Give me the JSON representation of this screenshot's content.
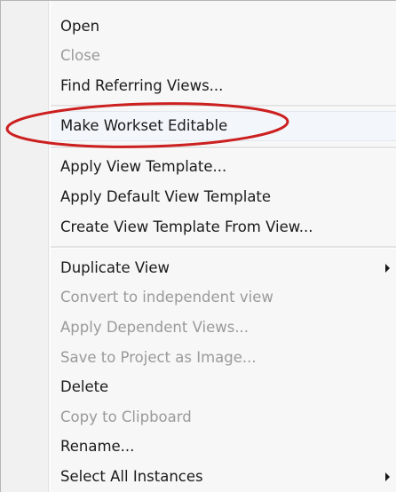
{
  "menu": {
    "items": [
      {
        "label": "Open",
        "enabled": true
      },
      {
        "label": "Close",
        "enabled": false
      },
      {
        "label": "Find Referring Views...",
        "enabled": true
      },
      {
        "label": "Make Workset Editable",
        "enabled": true
      },
      {
        "label": "Apply View Template...",
        "enabled": true
      },
      {
        "label": "Apply Default View Template",
        "enabled": true
      },
      {
        "label": "Create View Template From View...",
        "enabled": true
      },
      {
        "label": "Duplicate View",
        "enabled": true,
        "submenu": true
      },
      {
        "label": "Convert to independent view",
        "enabled": false
      },
      {
        "label": "Apply Dependent Views...",
        "enabled": false
      },
      {
        "label": "Save to Project as Image...",
        "enabled": false
      },
      {
        "label": "Delete",
        "enabled": true
      },
      {
        "label": "Copy to Clipboard",
        "enabled": false
      },
      {
        "label": "Rename...",
        "enabled": true
      },
      {
        "label": "Select All Instances",
        "enabled": true,
        "submenu": true
      }
    ]
  },
  "annotation": {
    "highlight_color": "#cc1f1f"
  },
  "colors": {
    "text": "#1a1a1a",
    "disabled_text": "#9a9a9a",
    "menu_bg": "#f7f7f7"
  }
}
